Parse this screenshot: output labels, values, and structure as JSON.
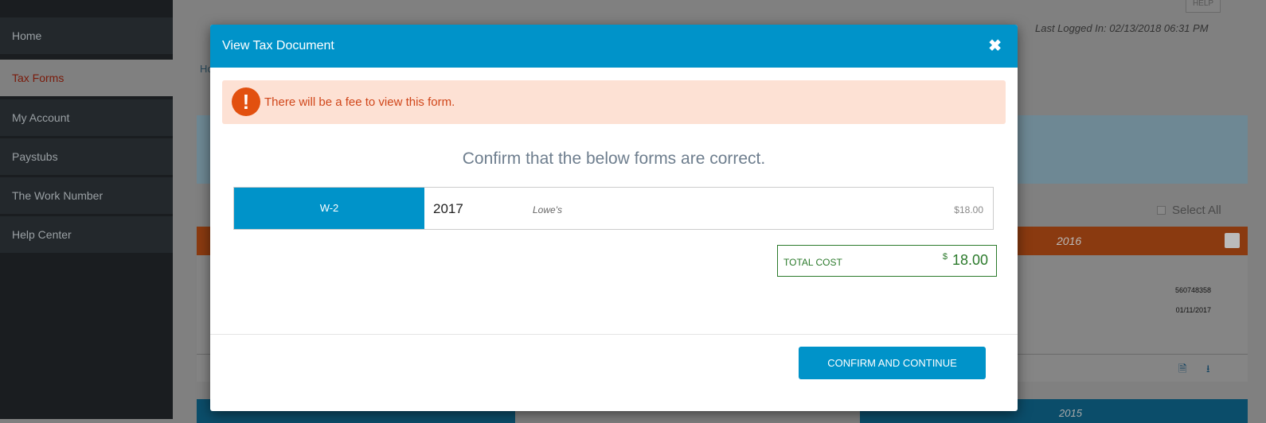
{
  "sidebar": {
    "items": [
      {
        "label": "Home"
      },
      {
        "label": "Tax Forms",
        "active": true
      },
      {
        "label": "My Account"
      },
      {
        "label": "Paystubs"
      },
      {
        "label": "The Work Number"
      },
      {
        "label": "Help Center"
      }
    ]
  },
  "header": {
    "help": "HELP",
    "last_logged": "Last Logged In: 02/13/2018 06:31 PM",
    "breadcrumb": "Ho"
  },
  "background": {
    "select_all": "Select All",
    "card": {
      "year": "2016",
      "value1": "560748358",
      "value2": "01/11/2017",
      "color": "#8a3a10"
    },
    "card2_year": "2015"
  },
  "modal": {
    "title": "View Tax Document",
    "close_icon": "close-icon",
    "alert": "There will be a fee to view this form.",
    "confirm_text": "Confirm that the below forms are correct.",
    "forms": [
      {
        "type": "W-2",
        "year": "2017",
        "employer": "Lowe's",
        "price": "$18.00"
      }
    ],
    "total_label": "TOTAL COST",
    "total_currency": "$",
    "total_amount": "18.00",
    "button": "CONFIRM AND CONTINUE",
    "accent": "#0093c9"
  }
}
